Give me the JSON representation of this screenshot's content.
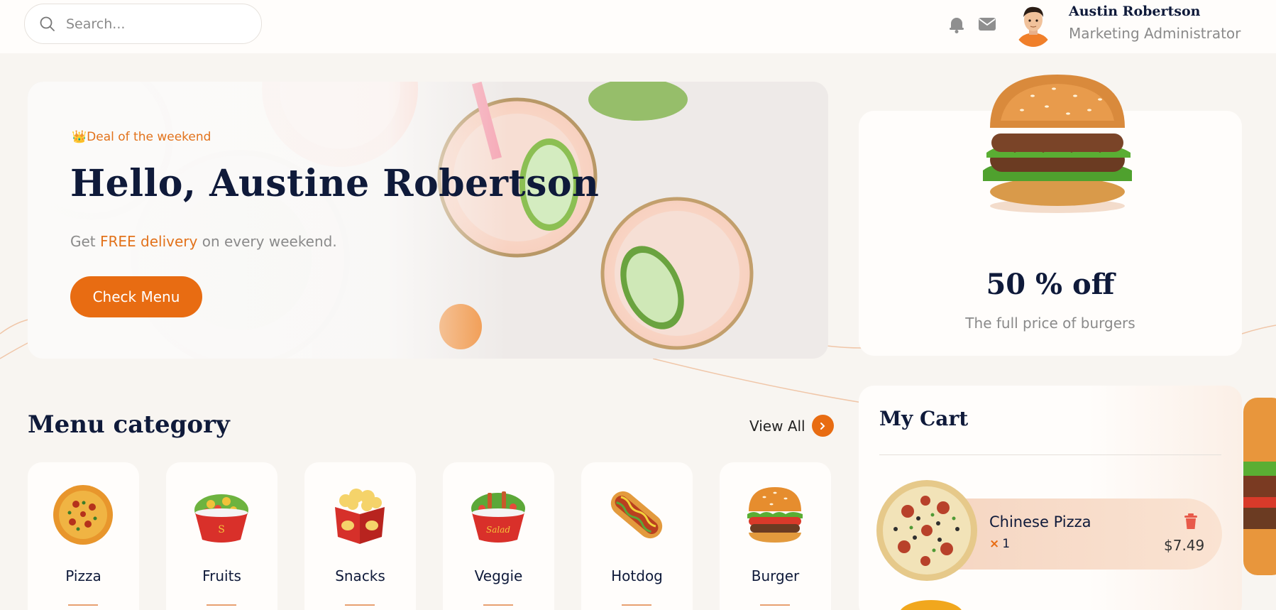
{
  "search": {
    "placeholder": "Search..."
  },
  "header": {
    "icons": [
      "bell-icon",
      "mail-icon"
    ],
    "user": {
      "name": "Austin Robertson",
      "role": "Marketing Administrator"
    }
  },
  "hero": {
    "badge_icon": "👑",
    "badge": "Deal of the weekend",
    "title": "Hello, Austine Robertson",
    "subtitle_before": "Get ",
    "subtitle_highlight": "FREE delivery",
    "subtitle_after": " on every weekend.",
    "button": "Check Menu"
  },
  "promo": {
    "title": "50 % off",
    "subtitle": "The full price of burgers"
  },
  "menu": {
    "title": "Menu category",
    "view_all": "View All",
    "categories": [
      {
        "label": "Pizza",
        "icon": "pizza-icon"
      },
      {
        "label": "Fruits",
        "icon": "fruit-bowl-icon"
      },
      {
        "label": "Snacks",
        "icon": "popcorn-icon"
      },
      {
        "label": "Veggie",
        "icon": "salad-icon"
      },
      {
        "label": "Hotdog",
        "icon": "hotdog-icon"
      },
      {
        "label": "Burger",
        "icon": "burger-icon"
      }
    ]
  },
  "cart": {
    "title": "My Cart",
    "items": [
      {
        "name": "Chinese Pizza",
        "qty_symbol": "×",
        "qty": "1",
        "price": "$7.49"
      }
    ]
  },
  "colors": {
    "accent": "#e86c12",
    "text_dark": "#0f1a3a",
    "text_muted": "#8a8a8a",
    "background": "#f8f5f1"
  }
}
